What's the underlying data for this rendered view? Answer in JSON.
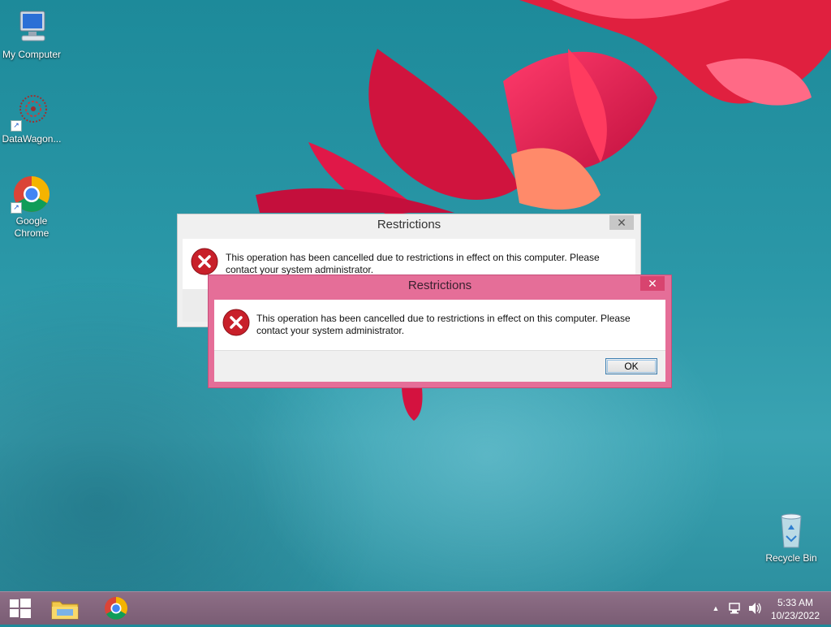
{
  "desktop": {
    "icons": [
      {
        "label": "My Computer"
      },
      {
        "label": "DataWagon..."
      },
      {
        "label": "Google Chrome"
      },
      {
        "label": "Recycle Bin"
      }
    ]
  },
  "dialogs": {
    "back": {
      "title": "Restrictions",
      "close": "✕",
      "message": "This operation has been cancelled due to restrictions in effect on this computer. Please contact your system administrator."
    },
    "front": {
      "title": "Restrictions",
      "close": "✕",
      "message": "This operation has been cancelled due to restrictions in effect on this computer. Please contact your system administrator.",
      "ok_label": "OK"
    }
  },
  "taskbar": {
    "tray_expand": "▲",
    "time": "5:33 AM",
    "date": "10/23/2022"
  },
  "colors": {
    "active_frame": "#e56e98",
    "close_button": "#d8446f",
    "taskbar": "#7a5d74"
  }
}
